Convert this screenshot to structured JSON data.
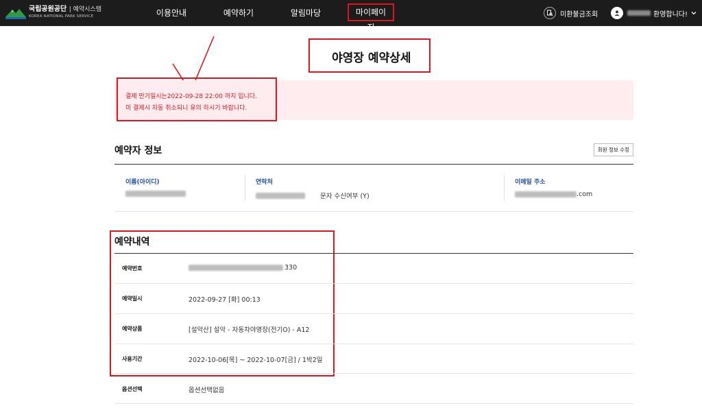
{
  "header": {
    "logo_main": "국립공원공단",
    "logo_system": "| 예약시스템",
    "logo_sub": "KOREA NATIONAL PARK SERVICE",
    "nav": [
      {
        "label": "이용안내"
      },
      {
        "label": "예약하기"
      },
      {
        "label": "알림마당"
      },
      {
        "label": "마이페이지"
      }
    ],
    "unpaid_refund_label": "미환불금조회",
    "welcome_label": "환영합니다!"
  },
  "page": {
    "title": "야영장 예약상세"
  },
  "alert": {
    "line1": "결제 만기일시는2022-09-28 22:00 까지 입니다.",
    "line2": "미 결제시 자동 취소되니 유의 하시기 바랍니다."
  },
  "booker": {
    "section_title": "예약자 정보",
    "edit_button": "회원 정보 수정",
    "name_label": "이름(아이디)",
    "phone_label": "연락처",
    "sms_consent": "문자 수신여부 (Y)",
    "email_label": "이메일 주소",
    "email_suffix": ".com"
  },
  "reservation": {
    "section_title": "예약내역",
    "rows": [
      {
        "label": "예약번호",
        "value": "330"
      },
      {
        "label": "예약일시",
        "value": "2022-09-27 [화] 00:13"
      },
      {
        "label": "예약상품",
        "value": "[설악산] 설악 - 자동차야영장(전기O) - A12"
      },
      {
        "label": "사용기간",
        "value": "2022-10-06[목] ~ 2022-10-07[금] / 1박2일"
      },
      {
        "label": "옵션선택",
        "value": "옵션선택없음"
      }
    ]
  },
  "colors": {
    "header_bg": "#1c1c1c",
    "annotation_red": "#e0161c",
    "alert_bg": "#ffecef",
    "label_blue": "#1f4ea3"
  }
}
